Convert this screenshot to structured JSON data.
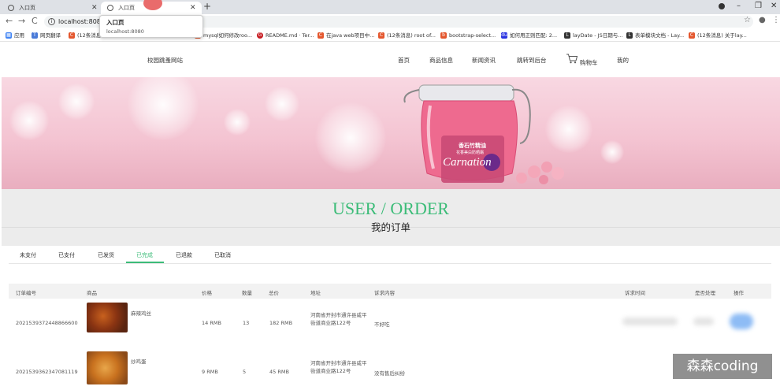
{
  "browser": {
    "tabs": [
      {
        "title": "入口页"
      },
      {
        "title": "入口页"
      }
    ],
    "url": "localhost:8080",
    "tooltip": {
      "title": "入口页",
      "url": "localhost:8080"
    },
    "bookmarks": [
      {
        "label": "应用",
        "icon": "apps-grid-icon",
        "color": "#4285f4"
      },
      {
        "label": "网页翻译",
        "icon": "translate-icon",
        "color": "#4a7bd8"
      },
      {
        "label": "(12条消息...",
        "icon": "csdn-icon",
        "color": "#e4572e"
      },
      {
        "label": "mysql如何修改roo...",
        "icon": "csdn-icon",
        "color": "#e4572e"
      },
      {
        "label": "README.md · Ter...",
        "icon": "gitee-icon",
        "color": "#c71d23"
      },
      {
        "label": "在java web项目中...",
        "icon": "csdn-icon",
        "color": "#e4572e"
      },
      {
        "label": "(12条消息) root of...",
        "icon": "csdn-icon",
        "color": "#e4572e"
      },
      {
        "label": "bootstrap-select...",
        "icon": "bookmark-icon",
        "color": "#e4572e"
      },
      {
        "label": "如何用正则匹配: 2...",
        "icon": "baidu-icon",
        "color": "#2932e1"
      },
      {
        "label": "layDate - JS日期与...",
        "icon": "layui-icon",
        "color": "#333333"
      },
      {
        "label": "表单模块文档 - Lay...",
        "icon": "layui-icon",
        "color": "#333333"
      },
      {
        "label": "(12条消息) 关于lay...",
        "icon": "csdn-icon",
        "color": "#e4572e"
      }
    ]
  },
  "site": {
    "brand": "校园跳蚤网站",
    "nav": [
      "首页",
      "商品信息",
      "新闻资讯",
      "跳转到后台",
      "购物车",
      "我的"
    ],
    "banner": {
      "product_brand": "Carnation",
      "product_text": "香石竹精油",
      "product_subtext": "花香美白防晒霜"
    },
    "title_en": "USER / ORDER",
    "title_cn": "我的订单",
    "order_tabs": [
      "未支付",
      "已支付",
      "已发货",
      "已完成",
      "已退款",
      "已取消"
    ],
    "active_tab": "已完成",
    "accent": "#3cbc78"
  },
  "table": {
    "headers": [
      "订单编号",
      "商品",
      "价格",
      "数量",
      "总价",
      "地址",
      "诉求内容",
      "诉求时间",
      "是否处理",
      "操作"
    ],
    "rows": [
      {
        "order_no": "2021539372448866600",
        "product": "麻辣鸡丝",
        "price": "14 RMB",
        "qty": "13",
        "total": "182 RMB",
        "address": "河南省开封市通许县咸平街道商业路122号",
        "request": "不好吃"
      },
      {
        "order_no": "2021539362347081119",
        "product": "炒鸡蛋",
        "price": "9 RMB",
        "qty": "5",
        "total": "45 RMB",
        "address": "河南省开封市通许县咸平街道商业路122号",
        "request": "没有售后纠纷"
      }
    ]
  },
  "watermark": "森森coding"
}
